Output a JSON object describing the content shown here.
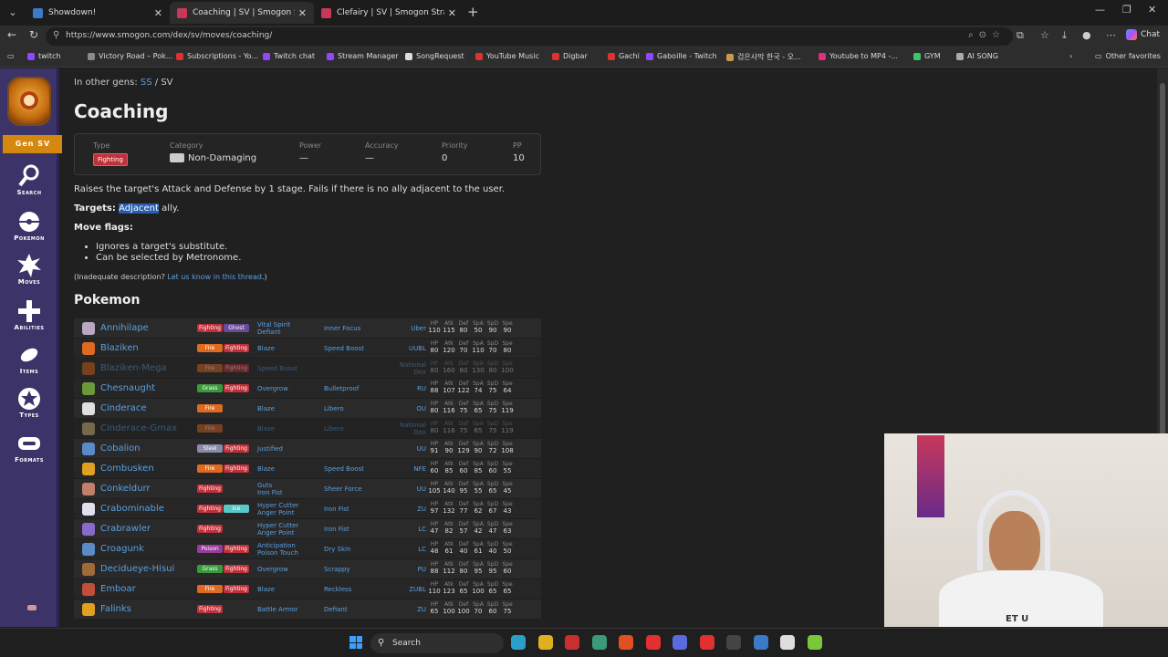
{
  "browser": {
    "tabs": [
      {
        "label": "Showdown!",
        "color": "#3a7ac8",
        "active": false
      },
      {
        "label": "Coaching | SV | Smogon Strategy Pokedex",
        "color": "#c8385a",
        "active": true
      },
      {
        "label": "Clefairy | SV | Smogon Strategy Pokedex",
        "color": "#c8385a",
        "active": false
      }
    ],
    "url": "https://www.smogon.com/dex/sv/moves/coaching/",
    "chat_label": "Chat",
    "bookmarks": [
      {
        "label": "twitch",
        "color": "#9146ff"
      },
      {
        "label": "Victory Road – Pok...",
        "color": "#8a8a8a"
      },
      {
        "label": "Subscriptions - Yo...",
        "color": "#e03030"
      },
      {
        "label": "Twitch chat",
        "color": "#9146ff"
      },
      {
        "label": "Stream Manager",
        "color": "#9146ff"
      },
      {
        "label": "SongRequest",
        "color": "#dddddd"
      },
      {
        "label": "YouTube Music",
        "color": "#e03030"
      },
      {
        "label": "Digbar",
        "color": "#e03030"
      },
      {
        "label": "Gachi",
        "color": "#e03030"
      },
      {
        "label": "Gaboille - Twitch",
        "color": "#9146ff"
      },
      {
        "label": "검은사막 한국 - 오...",
        "color": "#c89a50"
      },
      {
        "label": "Youtube to MP4 -...",
        "color": "#e0307a"
      },
      {
        "label": "GYM",
        "color": "#3ac86a"
      },
      {
        "label": "AI SONG",
        "color": "#aaaaaa"
      }
    ],
    "other_favorites": "Other favorites"
  },
  "sidebar": {
    "gen_label": "Gen SV",
    "items": [
      {
        "label": "Search",
        "icon": "search-icon"
      },
      {
        "label": "Pokemon",
        "icon": "pokeball-icon"
      },
      {
        "label": "Moves",
        "icon": "burst-icon"
      },
      {
        "label": "Abilities",
        "icon": "plus-icon"
      },
      {
        "label": "Items",
        "icon": "item-icon"
      },
      {
        "label": "Types",
        "icon": "star-icon"
      },
      {
        "label": "Formats",
        "icon": "formats-icon"
      }
    ]
  },
  "move": {
    "other_gens_prefix": "In other gens:",
    "other_gens": [
      "SS",
      "SV"
    ],
    "title": "Coaching",
    "stats": {
      "type_label": "Type",
      "type_value": "Fighting",
      "category_label": "Category",
      "category_value": "Non-Damaging",
      "power_label": "Power",
      "power_value": "—",
      "accuracy_label": "Accuracy",
      "accuracy_value": "—",
      "priority_label": "Priority",
      "priority_value": "0",
      "pp_label": "PP",
      "pp_value": "10"
    },
    "description": "Raises the target's Attack and Defense by 1 stage. Fails if there is no ally adjacent to the user.",
    "targets_label": "Targets:",
    "targets_highlight": "Adjacent",
    "targets_rest": " ally.",
    "flags_header": "Move flags:",
    "flags": [
      "Ignores a target's substitute.",
      "Can be selected by Metronome."
    ],
    "inadequate_prefix": "(Inadequate description? ",
    "inadequate_link": "Let us know in this thread",
    "inadequate_suffix": ".)"
  },
  "pokemon_header": "Pokemon",
  "stat_labels": [
    "HP",
    "Atk",
    "Def",
    "SpA",
    "SpD",
    "Spe"
  ],
  "type_colors": {
    "Fighting": "#c0303a",
    "Ghost": "#6a4a9a",
    "Fire": "#e06a20",
    "Grass": "#3a9a3a",
    "Steel": "#8a8aaa",
    "Ice": "#5ac8c8",
    "Poison": "#9a3a9a"
  },
  "pokemon": [
    {
      "name": "Annihilape",
      "types": [
        "Fighting",
        "Ghost"
      ],
      "abilities": [
        "Vital Spirit",
        "Defiant"
      ],
      "hidden": "Inner Focus",
      "tier": [
        "Uber"
      ],
      "stats": [
        "110",
        "115",
        "80",
        "50",
        "90",
        "90"
      ],
      "dim": false,
      "color": "#b8a8c0"
    },
    {
      "name": "Blaziken",
      "types": [
        "Fire",
        "Fighting"
      ],
      "abilities": [
        "Blaze"
      ],
      "hidden": "Speed Boost",
      "tier": [
        "UUBL"
      ],
      "stats": [
        "80",
        "120",
        "70",
        "110",
        "70",
        "80"
      ],
      "dim": false,
      "color": "#e06a20"
    },
    {
      "name": "Blaziken-Mega",
      "types": [
        "Fire",
        "Fighting"
      ],
      "abilities": [
        "Speed Boost"
      ],
      "hidden": "",
      "tier": [
        "National",
        "Dex"
      ],
      "stats": [
        "80",
        "160",
        "80",
        "130",
        "80",
        "100"
      ],
      "dim": true,
      "color": "#e06a20"
    },
    {
      "name": "Chesnaught",
      "types": [
        "Grass",
        "Fighting"
      ],
      "abilities": [
        "Overgrow"
      ],
      "hidden": "Bulletproof",
      "tier": [
        "RU"
      ],
      "stats": [
        "88",
        "107",
        "122",
        "74",
        "75",
        "64"
      ],
      "dim": false,
      "color": "#6a9a3a"
    },
    {
      "name": "Cinderace",
      "types": [
        "Fire"
      ],
      "abilities": [
        "Blaze"
      ],
      "hidden": "Libero",
      "tier": [
        "OU"
      ],
      "stats": [
        "80",
        "116",
        "75",
        "65",
        "75",
        "119"
      ],
      "dim": false,
      "color": "#e0e0e0"
    },
    {
      "name": "Cinderace-Gmax",
      "types": [
        "Fire"
      ],
      "abilities": [
        "Blaze"
      ],
      "hidden": "Libero",
      "tier": [
        "National",
        "Dex"
      ],
      "stats": [
        "80",
        "116",
        "75",
        "65",
        "75",
        "119"
      ],
      "dim": true,
      "color": "#e0c080"
    },
    {
      "name": "Cobalion",
      "types": [
        "Steel",
        "Fighting"
      ],
      "abilities": [
        "Justified"
      ],
      "hidden": "",
      "tier": [
        "UU"
      ],
      "stats": [
        "91",
        "90",
        "129",
        "90",
        "72",
        "108"
      ],
      "dim": false,
      "color": "#5a8ac8"
    },
    {
      "name": "Combusken",
      "types": [
        "Fire",
        "Fighting"
      ],
      "abilities": [
        "Blaze"
      ],
      "hidden": "Speed Boost",
      "tier": [
        "NFE"
      ],
      "stats": [
        "60",
        "85",
        "60",
        "85",
        "60",
        "55"
      ],
      "dim": false,
      "color": "#e0a020"
    },
    {
      "name": "Conkeldurr",
      "types": [
        "Fighting"
      ],
      "abilities": [
        "Guts",
        "Iron Fist"
      ],
      "hidden": "Sheer Force",
      "tier": [
        "UU"
      ],
      "stats": [
        "105",
        "140",
        "95",
        "55",
        "65",
        "45"
      ],
      "dim": false,
      "color": "#c0806a"
    },
    {
      "name": "Crabominable",
      "types": [
        "Fighting",
        "Ice"
      ],
      "abilities": [
        "Hyper Cutter",
        "Anger Point"
      ],
      "hidden": "Iron Fist",
      "tier": [
        "ZU"
      ],
      "stats": [
        "97",
        "132",
        "77",
        "62",
        "67",
        "43"
      ],
      "dim": false,
      "color": "#e0e0f0"
    },
    {
      "name": "Crabrawler",
      "types": [
        "Fighting"
      ],
      "abilities": [
        "Hyper Cutter",
        "Anger Point"
      ],
      "hidden": "Iron Fist",
      "tier": [
        "LC"
      ],
      "stats": [
        "47",
        "82",
        "57",
        "42",
        "47",
        "63"
      ],
      "dim": false,
      "color": "#8a6ac8"
    },
    {
      "name": "Croagunk",
      "types": [
        "Poison",
        "Fighting"
      ],
      "abilities": [
        "Anticipation",
        "Poison Touch"
      ],
      "hidden": "Dry Skin",
      "tier": [
        "LC"
      ],
      "stats": [
        "48",
        "61",
        "40",
        "61",
        "40",
        "50"
      ],
      "dim": false,
      "color": "#5a8ac8"
    },
    {
      "name": "Decidueye-Hisui",
      "types": [
        "Grass",
        "Fighting"
      ],
      "abilities": [
        "Overgrow"
      ],
      "hidden": "Scrappy",
      "tier": [
        "PU"
      ],
      "stats": [
        "88",
        "112",
        "80",
        "95",
        "95",
        "60"
      ],
      "dim": false,
      "color": "#a06a3a"
    },
    {
      "name": "Emboar",
      "types": [
        "Fire",
        "Fighting"
      ],
      "abilities": [
        "Blaze"
      ],
      "hidden": "Reckless",
      "tier": [
        "ZUBL"
      ],
      "stats": [
        "110",
        "123",
        "65",
        "100",
        "65",
        "65"
      ],
      "dim": false,
      "color": "#c0503a"
    },
    {
      "name": "Falinks",
      "types": [
        "Fighting"
      ],
      "abilities": [
        "Battle Armor"
      ],
      "hidden": "Defiant",
      "tier": [
        "ZU"
      ],
      "stats": [
        "65",
        "100",
        "100",
        "70",
        "60",
        "75"
      ],
      "dim": false,
      "color": "#e0a020"
    }
  ],
  "taskbar": {
    "search_label": "Search",
    "apps": [
      {
        "icon": "edge-icon",
        "color": "#2aa0c8"
      },
      {
        "icon": "folder-icon",
        "color": "#e0b020"
      },
      {
        "icon": "record-icon",
        "color": "#c83030"
      },
      {
        "icon": "chatgpt-icon",
        "color": "#3a9a7a"
      },
      {
        "icon": "brave-icon",
        "color": "#e05020"
      },
      {
        "icon": "youtube-icon",
        "color": "#e03030"
      },
      {
        "icon": "discord-icon",
        "color": "#5a6ae0"
      },
      {
        "icon": "opera-icon",
        "color": "#e03030"
      },
      {
        "icon": "obs-icon",
        "color": "#444444"
      },
      {
        "icon": "vscode-icon",
        "color": "#3a7ac8"
      },
      {
        "icon": "capcut-icon",
        "color": "#dddddd"
      },
      {
        "icon": "bluestacks-icon",
        "color": "#7ac83a"
      }
    ]
  }
}
